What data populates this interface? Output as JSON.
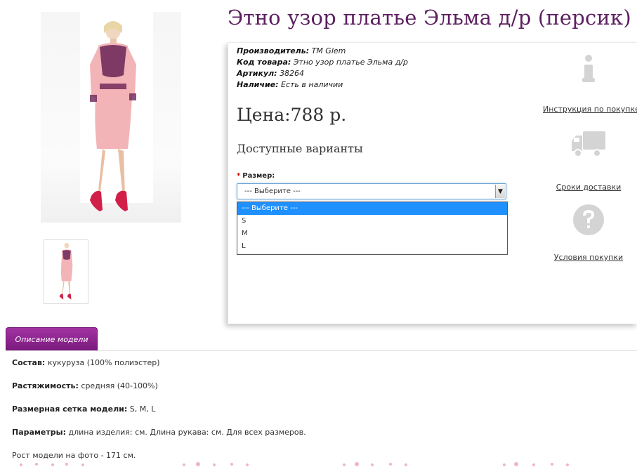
{
  "product": {
    "title": "Этно узор платье Эльма д/р (персик)",
    "manufacturer_label": "Производитель:",
    "manufacturer_value": "ТМ Glem",
    "code_label": "Код товара:",
    "code_value": "Этно узор платье Эльма д/р",
    "sku_label": "Артикул:",
    "sku_value": "38264",
    "stock_label": "Наличие:",
    "stock_value": "Есть в наличии",
    "price": "Цена:788 р.",
    "variants_heading": "Доступные варианты",
    "size_label": "Размер:",
    "required_mark": "*",
    "size_select": {
      "selected": "--- Выберите ---",
      "options": [
        "--- Выберите ---",
        "S",
        "M",
        "L"
      ]
    }
  },
  "side_links": [
    {
      "label": "Инструкция по покупке",
      "icon": "info-icon"
    },
    {
      "label": "Сроки доставки",
      "icon": "delivery-truck-icon"
    },
    {
      "label": "Условия покупки",
      "icon": "question-icon"
    }
  ],
  "tabs": [
    {
      "label": "Описание модели"
    }
  ],
  "description": [
    {
      "key": "Состав:",
      "value": "кукуруза (100% полиэстер)"
    },
    {
      "key": "Растяжимость:",
      "value": "средняя (40-100%)"
    },
    {
      "key": "Размерная сетка модели:",
      "value": "S, M, L"
    },
    {
      "key": "Параметры:",
      "value": "длина изделия: см. Длина рукава: см. Для всех размеров."
    },
    {
      "key": "",
      "value": "Рост модели на фото - 171 см."
    }
  ],
  "colors": {
    "title": "#5b1f5f",
    "tab": "#8a228d",
    "dress": "#f2b4b6",
    "pattern": "#6a2357",
    "shoes": "#d21f4a",
    "select_highlight": "#1e90ff"
  }
}
